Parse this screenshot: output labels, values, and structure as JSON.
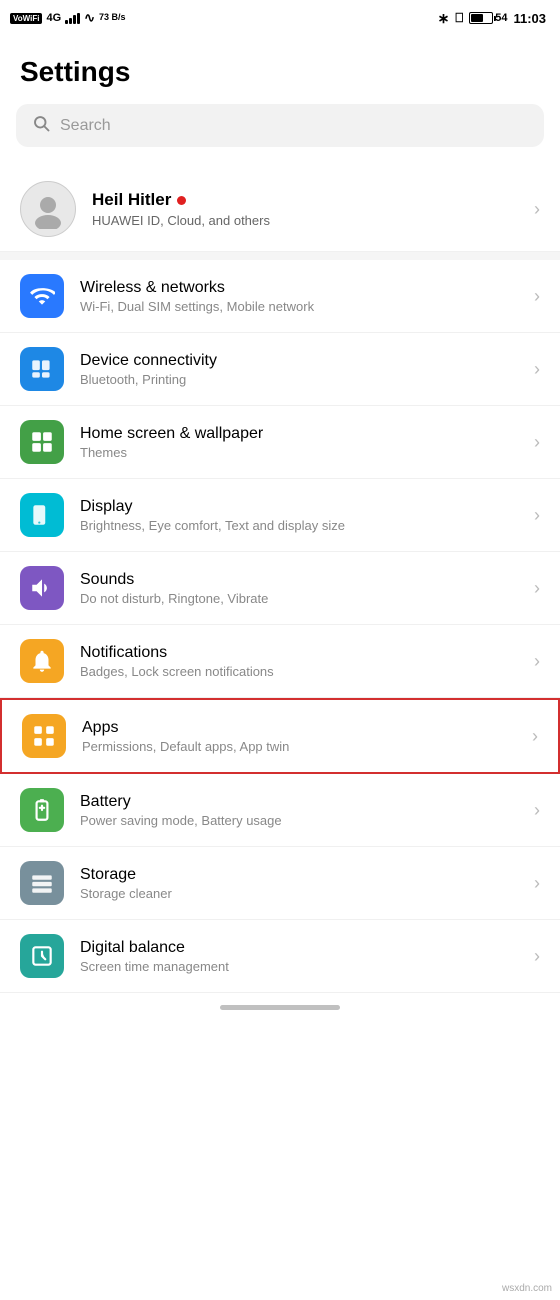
{
  "statusBar": {
    "leftItems": [
      "VoWiFi",
      "4G",
      "signal",
      "WiFi",
      "73 B/s"
    ],
    "battery": "54",
    "time": "11:03"
  },
  "pageTitle": "Settings",
  "search": {
    "placeholder": "Search"
  },
  "profile": {
    "name": "Heil Hitler",
    "subtitle": "HUAWEI ID, Cloud, and others"
  },
  "settings": [
    {
      "id": "wireless",
      "title": "Wireless & networks",
      "subtitle": "Wi-Fi, Dual SIM settings, Mobile network",
      "iconColor": "icon-blue",
      "highlighted": false
    },
    {
      "id": "connectivity",
      "title": "Device connectivity",
      "subtitle": "Bluetooth, Printing",
      "iconColor": "icon-blue2",
      "highlighted": false
    },
    {
      "id": "homescreen",
      "title": "Home screen & wallpaper",
      "subtitle": "Themes",
      "iconColor": "icon-green",
      "highlighted": false
    },
    {
      "id": "display",
      "title": "Display",
      "subtitle": "Brightness, Eye comfort, Text and display size",
      "iconColor": "icon-green2",
      "highlighted": false
    },
    {
      "id": "sounds",
      "title": "Sounds",
      "subtitle": "Do not disturb, Ringtone, Vibrate",
      "iconColor": "icon-purple",
      "highlighted": false
    },
    {
      "id": "notifications",
      "title": "Notifications",
      "subtitle": "Badges, Lock screen notifications",
      "iconColor": "icon-yellow-orange",
      "highlighted": false
    },
    {
      "id": "apps",
      "title": "Apps",
      "subtitle": "Permissions, Default apps, App twin",
      "iconColor": "icon-yellow-orange",
      "highlighted": true
    },
    {
      "id": "battery",
      "title": "Battery",
      "subtitle": "Power saving mode, Battery usage",
      "iconColor": "icon-green3",
      "highlighted": false
    },
    {
      "id": "storage",
      "title": "Storage",
      "subtitle": "Storage cleaner",
      "iconColor": "icon-gray",
      "highlighted": false
    },
    {
      "id": "digitalbalance",
      "title": "Digital balance",
      "subtitle": "Screen time management",
      "iconColor": "icon-teal2",
      "highlighted": false
    }
  ]
}
